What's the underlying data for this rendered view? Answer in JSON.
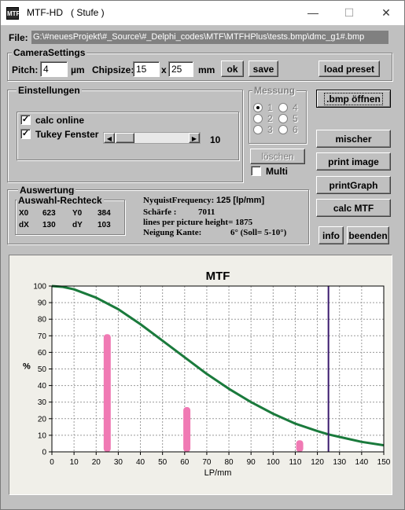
{
  "window": {
    "title": "MTF-HD",
    "subtitle": "( Stufe )",
    "icon_text": "MTF",
    "minimize": "—",
    "maximize": "☐",
    "close": "✕"
  },
  "file": {
    "label": "File:",
    "path": "G:\\#neuesProjekt\\#_Source\\#_Delphi_codes\\MTF\\MTFHPlus\\tests.bmp\\dmc_g1#.bmp"
  },
  "camera": {
    "title": "CameraSettings",
    "pitch_label": "Pitch:",
    "pitch_value": "4",
    "pitch_unit": "µm",
    "chipsize_label": "Chipsize:",
    "chip_w": "15",
    "x_label": "x",
    "chip_h": "25",
    "chip_unit": "mm",
    "ok": "ok",
    "save": "save",
    "load_preset": "load preset"
  },
  "einstellungen": {
    "title": "Einstellungen",
    "calc_online": "calc online",
    "calc_online_checked": true,
    "tukey": "Tukey Fenster",
    "tukey_checked": true,
    "slider_value": "10",
    "slider_fraction": 0.1
  },
  "messung": {
    "title": "Messung",
    "radios": [
      "1",
      "2",
      "3",
      "4",
      "5",
      "6"
    ],
    "selected": "1",
    "loeschen": "löschen",
    "multi": "Multi",
    "multi_checked": false
  },
  "buttons": {
    "bmp_open": ".bmp öffnen",
    "mischer": "mischer",
    "print_image": "print image",
    "print_graph": "printGraph",
    "calc_mtf": "calc MTF",
    "info": "info",
    "beenden": "beenden"
  },
  "auswertung": {
    "title": "Auswertung",
    "rect_title": "Auswahl-Rechteck",
    "x0_label": "X0",
    "x0": "623",
    "y0_label": "Y0",
    "y0": "384",
    "dx_label": "dX",
    "dx": "130",
    "dy_label": "dY",
    "dy": "103"
  },
  "info": {
    "nyquist_label": "NyquistFrequency:",
    "nyquist_value": "125 [lp/mm]",
    "schaerfe_label": "Schärfe :",
    "schaerfe_value": "7011",
    "lines_text": "lines per picture height= 1875",
    "neigung_label": "Neigung Kante:",
    "neigung_value": "6° (Soll= 5-10°)"
  },
  "chart_data": {
    "type": "line",
    "title": "MTF",
    "xlabel": "LP/mm",
    "ylabel": "%",
    "xlim": [
      0,
      150
    ],
    "ylim": [
      0,
      100
    ],
    "xticks": [
      0,
      10,
      20,
      30,
      40,
      50,
      60,
      70,
      80,
      90,
      100,
      110,
      120,
      130,
      140,
      150
    ],
    "yticks": [
      0,
      10,
      20,
      30,
      40,
      50,
      60,
      70,
      80,
      90,
      100
    ],
    "grid": true,
    "series": [
      {
        "kind": "line",
        "color": "#1a7a3c",
        "x": [
          0,
          5,
          10,
          20,
          30,
          40,
          50,
          60,
          70,
          80,
          90,
          100,
          110,
          120,
          125,
          130,
          140,
          150
        ],
        "y": [
          100,
          99.5,
          98,
          93,
          86,
          77,
          67,
          57,
          47,
          38,
          30,
          23,
          17,
          12.5,
          10.5,
          9,
          6,
          4
        ]
      },
      {
        "kind": "bars",
        "color": "#f07ab4",
        "x": [
          25,
          61,
          112
        ],
        "y": [
          71,
          27,
          7
        ]
      },
      {
        "kind": "vline",
        "color": "#3a1a6e",
        "x": 125
      }
    ]
  }
}
